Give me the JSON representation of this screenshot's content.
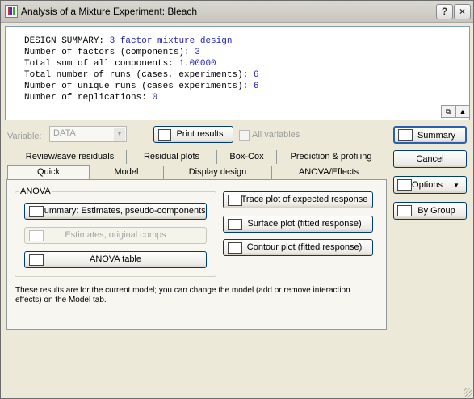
{
  "window": {
    "title": "Analysis of a Mixture Experiment: Bleach"
  },
  "titlebar": {
    "help": "?",
    "close": "×"
  },
  "output": {
    "lines": [
      {
        "label": "DESIGN SUMMARY: ",
        "value": "3 factor mixture design"
      },
      {
        "label": "Number of factors (components): ",
        "value": "3"
      },
      {
        "label": "Total sum of all components: ",
        "value": "1.00000"
      },
      {
        "label": "Total number of runs (cases, experiments): ",
        "value": "6"
      },
      {
        "label": "Number of unique runs (cases experiments): ",
        "value": "6"
      },
      {
        "label": "Number of replications: ",
        "value": "0"
      }
    ]
  },
  "variable": {
    "label": "Variable:",
    "value": "DATA"
  },
  "print_results": "Print results",
  "all_variables": "All variables",
  "tabs_row1": [
    "Review/save residuals",
    "Residual plots",
    "Box-Cox",
    "Prediction & profiling"
  ],
  "tabs_row2": [
    "Quick",
    "Model",
    "Display design",
    "ANOVA/Effects"
  ],
  "anova_group": {
    "title": "ANOVA",
    "summary_button": "Summary:  Estimates, pseudo-components",
    "estimates_original": "Estimates, original comps",
    "anova_table": "ANOVA table"
  },
  "plots": {
    "trace": "Trace plot of expected response",
    "surface": "Surface plot (fitted response)",
    "contour": "Contour plot (fitted response)"
  },
  "note": "These results are for the current model; you can change the model (add or remove interaction effects) on the Model tab.",
  "right_buttons": {
    "summary": "Summary",
    "cancel": "Cancel",
    "options": "Options",
    "by_group": "By Group"
  }
}
